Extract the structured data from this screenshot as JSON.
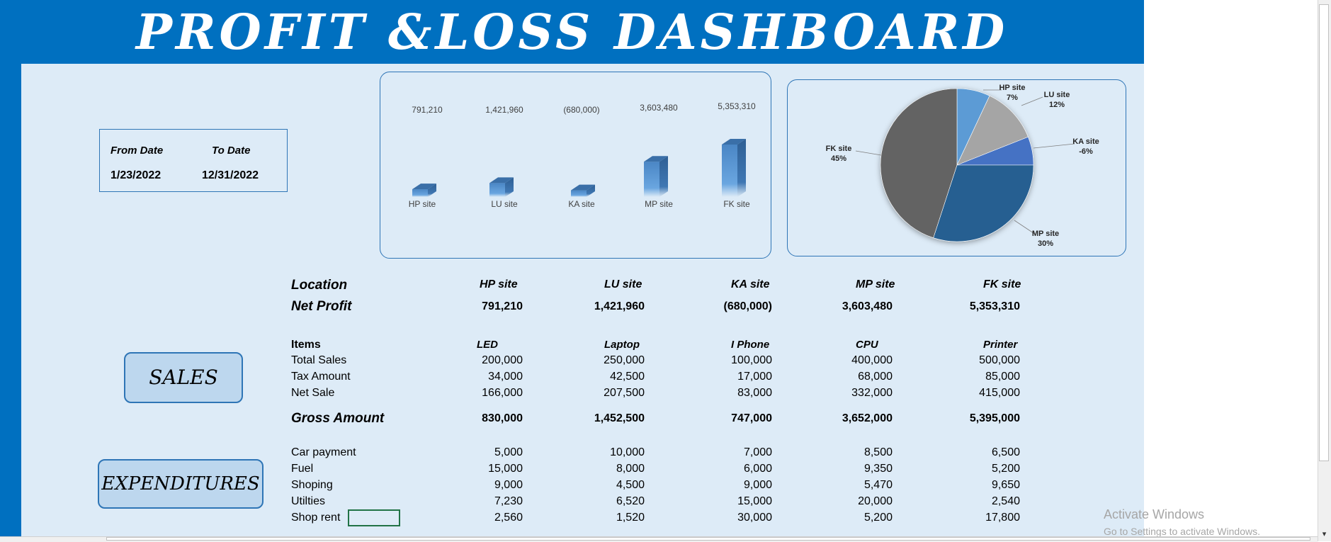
{
  "title": "PROFIT &LOSS DASHBOARD",
  "dates": {
    "from_label": "From Date",
    "to_label": "To Date",
    "from_value": "1/23/2022",
    "to_value": "12/31/2022"
  },
  "bar_chart": {
    "categories": [
      "HP site",
      "LU site",
      "KA site",
      "MP site",
      "FK site"
    ],
    "value_labels": [
      "791,210",
      "1,421,960",
      "(680,000)",
      "3,603,480",
      "5,353,310"
    ]
  },
  "pie_chart": {
    "labels": [
      {
        "name": "HP site",
        "pct": "7%"
      },
      {
        "name": "LU site",
        "pct": "12%"
      },
      {
        "name": "KA site",
        "pct": "-6%"
      },
      {
        "name": "MP site",
        "pct": "30%"
      },
      {
        "name": "FK site",
        "pct": "45%"
      }
    ]
  },
  "chart_data": [
    {
      "type": "bar",
      "categories": [
        "HP site",
        "LU site",
        "KA site",
        "MP site",
        "FK site"
      ],
      "values": [
        791210,
        1421960,
        -680000,
        3603480,
        5353310
      ],
      "colors": [
        "#5b9bd5"
      ]
    },
    {
      "type": "pie",
      "categories": [
        "HP site",
        "LU site",
        "KA site",
        "MP site",
        "FK site"
      ],
      "values": [
        7,
        12,
        -6,
        30,
        45
      ],
      "colors": [
        "#5b9bd5",
        "#a5a5a5",
        "#4472c4",
        "#255e91",
        "#636363"
      ]
    }
  ],
  "summary": {
    "location_label": "Location",
    "net_profit_label": "Net Profit",
    "locations": [
      "HP site",
      "LU site",
      "KA site",
      "MP site",
      "FK site"
    ],
    "net_profit": [
      "791,210",
      "1,421,960",
      "(680,000)",
      "3,603,480",
      "5,353,310"
    ]
  },
  "sales": {
    "button_label": "SALES",
    "items_label": "Items",
    "items": [
      "LED",
      "Laptop",
      "I Phone",
      "CPU",
      "Printer"
    ],
    "rows": [
      {
        "label": "Total Sales",
        "values": [
          "200,000",
          "250,000",
          "100,000",
          "400,000",
          "500,000"
        ]
      },
      {
        "label": "Tax Amount",
        "values": [
          "34,000",
          "42,500",
          "17,000",
          "68,000",
          "85,000"
        ]
      },
      {
        "label": "Net Sale",
        "values": [
          "166,000",
          "207,500",
          "83,000",
          "332,000",
          "415,000"
        ]
      }
    ],
    "gross_label": "Gross Amount",
    "gross": [
      "830,000",
      "1,452,500",
      "747,000",
      "3,652,000",
      "5,395,000"
    ]
  },
  "expenditures": {
    "button_label": "EXPENDITURES",
    "rows": [
      {
        "label": "Car payment",
        "values": [
          "5,000",
          "10,000",
          "7,000",
          "8,500",
          "6,500"
        ]
      },
      {
        "label": "Fuel",
        "values": [
          "15,000",
          "8,000",
          "6,000",
          "9,350",
          "5,200"
        ]
      },
      {
        "label": "Shoping",
        "values": [
          "9,000",
          "4,500",
          "9,000",
          "5,470",
          "9,650"
        ]
      },
      {
        "label": "Utilties",
        "values": [
          "7,230",
          "6,520",
          "15,000",
          "20,000",
          "2,540"
        ]
      },
      {
        "label": "Shop rent",
        "values": [
          "2,560",
          "1,520",
          "30,000",
          "5,200",
          "17,800"
        ]
      }
    ]
  },
  "watermark": {
    "line1": "Activate Windows",
    "line2": "Go to Settings to activate Windows."
  }
}
